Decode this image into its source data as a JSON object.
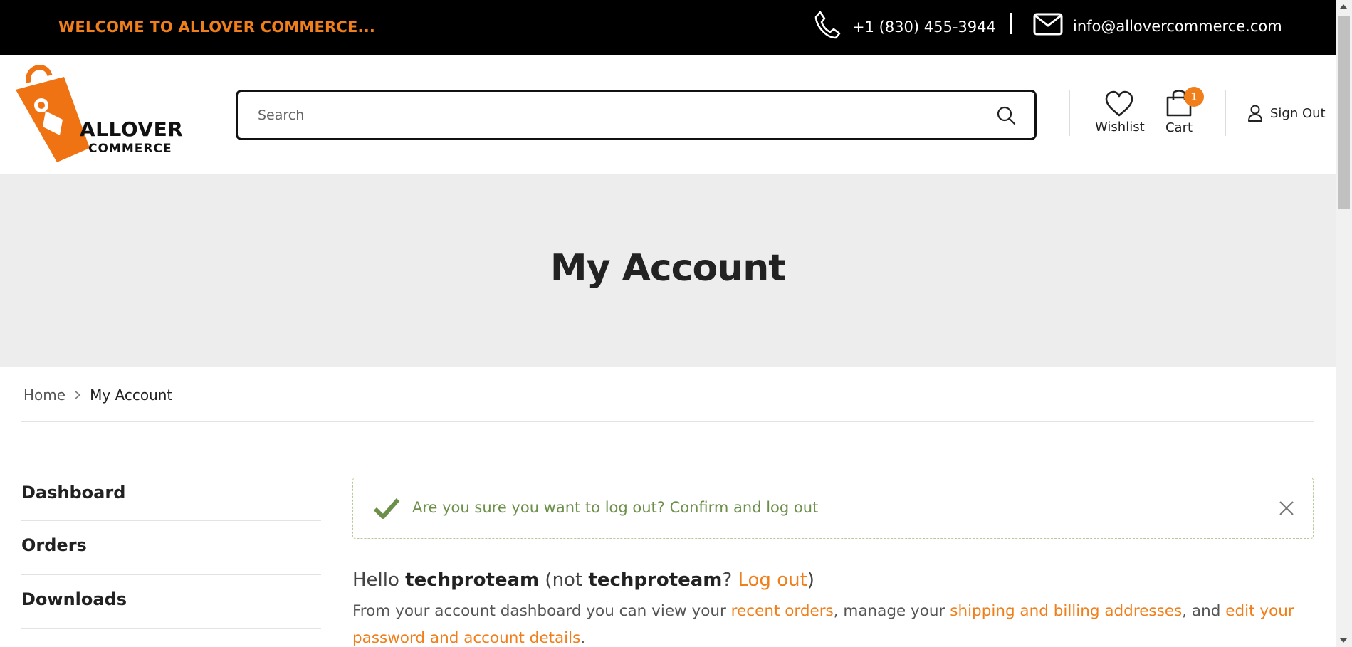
{
  "topbar": {
    "welcome": "WELCOME TO ALLOVER COMMERCE...",
    "phone": "+1 (830) 455-3944",
    "email": "info@allovercommerce.com"
  },
  "header": {
    "logo_line1": "ALLOVER",
    "logo_line2": "COMMERCE",
    "search_placeholder": "Search",
    "wishlist_label": "Wishlist",
    "cart_label": "Cart",
    "cart_count": "1",
    "signout_label": "Sign Out"
  },
  "hero": {
    "title": "My Account"
  },
  "breadcrumb": {
    "home": "Home",
    "current": "My Account"
  },
  "sidebar": {
    "items": [
      {
        "label": "Dashboard"
      },
      {
        "label": "Orders"
      },
      {
        "label": "Downloads"
      }
    ]
  },
  "notice": {
    "message": "Are you sure you want to log out? Confirm and log out"
  },
  "greeting": {
    "hello": "Hello",
    "user": "techproteam",
    "not": "(not",
    "user2": "techproteam",
    "q": "?",
    "logout": "Log out",
    "close_paren": ")"
  },
  "intro": {
    "part1": "From your account dashboard you can view your",
    "link1": "recent orders",
    "part2": ", manage your",
    "link2": "shipping and billing addresses",
    "part3": ", and",
    "link3": "edit your password and account details",
    "part4": "."
  },
  "colors": {
    "accent": "#f07f1b",
    "topbar_bg": "#000000",
    "hero_bg": "#ededed",
    "success_text": "#6c8f4a"
  },
  "icons": [
    "phone-icon",
    "mail-icon",
    "search-icon",
    "heart-icon",
    "shopping-bag-icon",
    "user-icon",
    "chevron-right-icon",
    "checkmark-icon",
    "close-icon"
  ]
}
